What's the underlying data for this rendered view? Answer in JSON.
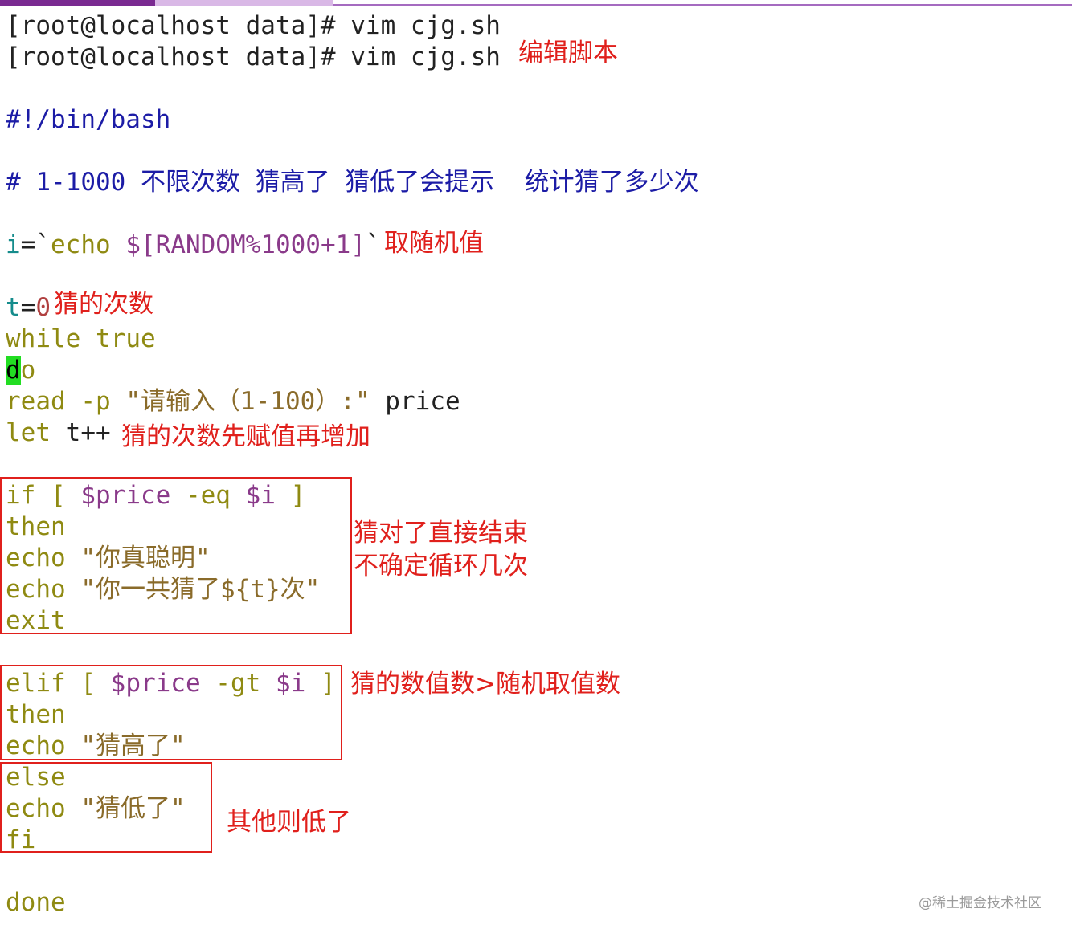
{
  "terminal": {
    "prompt_lines": [
      "[root@localhost data]# vim cjg.sh",
      "[root@localhost data]# vim cjg.sh"
    ]
  },
  "script": {
    "shebang": "#!/bin/bash",
    "comment": "# 1-1000 不限次数 猜高了 猜低了会提示  统计猜了多少次",
    "assign_i": {
      "var": "i",
      "eq": "=`",
      "cmd": "echo ",
      "expr": "$[RANDOM%1000+1]",
      "end": "`"
    },
    "assign_t": {
      "var": "t",
      "eq": "=",
      "val": "0"
    },
    "while_line": {
      "kw": "while",
      "arg": " true"
    },
    "do_line": {
      "cursor": "d",
      "rest": "o"
    },
    "read_line": {
      "kw": "read -p ",
      "str": "\"请输入（1-100）:\"",
      "var": " price"
    },
    "let_line": {
      "kw": "let",
      "rest": " t++"
    },
    "if_line": {
      "kw": "if [ ",
      "var1": "$price",
      "op": " -eq ",
      "var2": "$i",
      "end": " ]"
    },
    "then1": "then",
    "echo1": {
      "kw": "echo ",
      "str": "\"你真聪明\""
    },
    "echo2": {
      "kw": "echo ",
      "str": "\"你一共猜了${t}次\""
    },
    "exit": "exit",
    "elif_line": {
      "kw": "elif [ ",
      "var1": "$price",
      "op": " -gt ",
      "var2": "$i",
      "end": " ]"
    },
    "then2": "then",
    "echo3": {
      "kw": "echo ",
      "str": "\"猜高了\""
    },
    "else": "else",
    "echo4": {
      "kw": "echo ",
      "str": "\"猜低了\""
    },
    "fi": "fi",
    "done": "done"
  },
  "annotations": {
    "edit_script": "编辑脚本",
    "random_value": "取随机值",
    "guess_count": "猜的次数",
    "increment": "猜的次数先赋值再增加",
    "correct_end": "猜对了直接结束",
    "loop_unknown": "不确定循环几次",
    "greater": "猜的数值数>随机取值数",
    "else_lower": "其他则低了"
  },
  "watermark": "@稀土掘金技术社区",
  "colors": {
    "annotation_red": "#e0201c",
    "comment_blue": "#1c1ca6",
    "keyword_olive": "#8f8a12",
    "variable_teal": "#158c8c",
    "string_brown": "#8a6b2a",
    "cursor_green": "#22dd22",
    "tab_active": "#7a2a91"
  }
}
